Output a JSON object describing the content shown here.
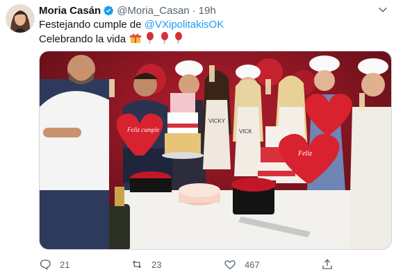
{
  "tweet": {
    "author_name": "Moria Casán",
    "handle": "@Moria_Casan",
    "separator": "·",
    "time": "19h",
    "text_line1_prefix": "Festejando cumple de ",
    "mention": "@VXipolitakisOK",
    "text_line2": "Celebrando la vida",
    "emojis": [
      "gift-emoji",
      "balloon-emoji",
      "balloon-emoji",
      "balloon-emoji"
    ]
  },
  "media": {
    "balloon_text_left": "Feliz cumple",
    "balloon_text_right": "Feliz",
    "apron_text_1": "VICKY",
    "apron_text_2": "VICK"
  },
  "actions": {
    "replies": "21",
    "retweets": "23",
    "likes": "467"
  },
  "colors": {
    "link": "#1d9bf0",
    "verified": "#1d9bf0",
    "muted": "#536471"
  }
}
